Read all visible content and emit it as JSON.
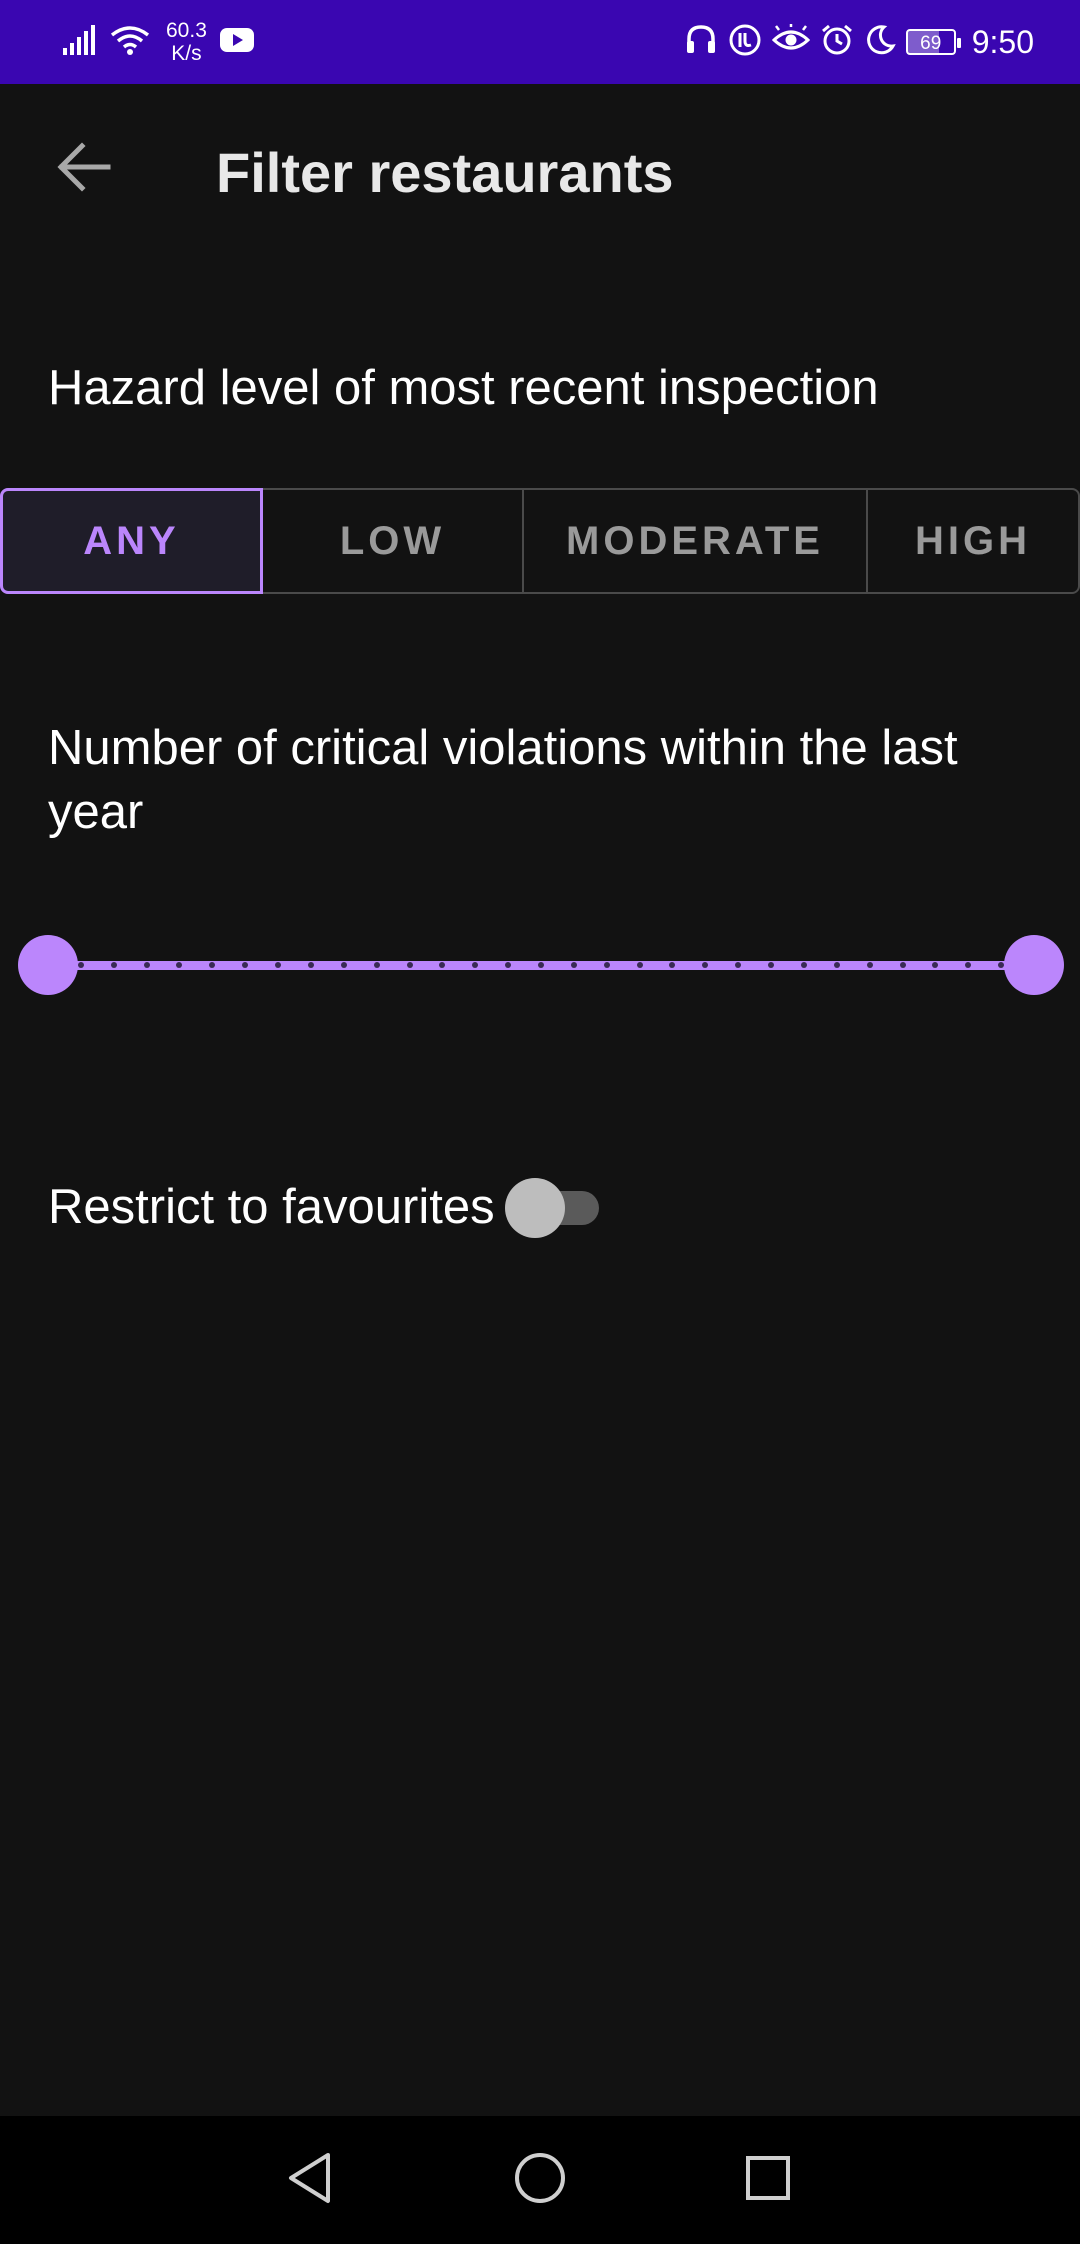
{
  "status_bar": {
    "network_speed_value": "60.3",
    "network_speed_unit": "K/s",
    "battery_level": "69",
    "time": "9:50",
    "icons": [
      "signal-icon",
      "wifi-icon",
      "youtube-icon",
      "headset-icon",
      "data-saver-icon",
      "eye-icon",
      "alarm-icon",
      "moon-icon",
      "battery-icon"
    ]
  },
  "app_bar": {
    "back_icon": "arrow-left-icon",
    "title": "Filter restaurants"
  },
  "hazard": {
    "label": "Hazard level of most recent inspection",
    "options": [
      "ANY",
      "LOW",
      "MODERATE",
      "HIGH"
    ],
    "selected": "ANY"
  },
  "violations": {
    "label_line1": "Number of critical violations within the last",
    "label_line2": "year",
    "range_start_fraction": 0,
    "range_end_fraction": 1,
    "tick_marks": 30
  },
  "favourites": {
    "label": "Restrict to favourites",
    "enabled": false
  },
  "colors": {
    "accent": "#bb86fc",
    "background": "#121212",
    "status_bar": "#3a06b1",
    "nav_bar": "#000000"
  },
  "nav_bar": {
    "icons": [
      "back-triangle-icon",
      "home-circle-icon",
      "recents-square-icon"
    ]
  }
}
